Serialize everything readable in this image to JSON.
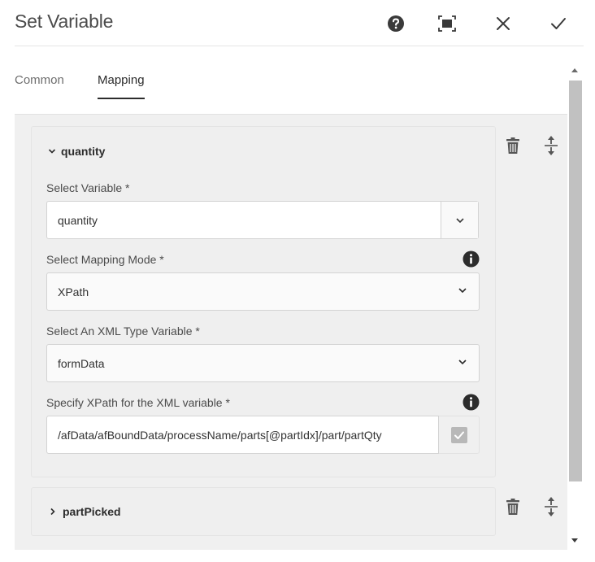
{
  "header": {
    "title": "Set Variable",
    "buttons": {
      "help": "help-icon",
      "fullscreen": "fullscreen-icon",
      "close": "close-icon",
      "confirm": "checkmark-icon"
    }
  },
  "tabs": [
    {
      "label": "Common",
      "active": false
    },
    {
      "label": "Mapping",
      "active": true
    }
  ],
  "mappings": [
    {
      "name": "quantity",
      "expanded": true,
      "fields": {
        "variable": {
          "label": "Select Variable *",
          "value": "quantity"
        },
        "mode": {
          "label": "Select Mapping Mode *",
          "value": "XPath"
        },
        "xml_var": {
          "label": "Select An XML Type Variable *",
          "value": "formData"
        },
        "xpath": {
          "label": "Specify XPath for the XML variable *",
          "value": "/afData/afBoundData/processName/parts[@partIdx]/part/partQty"
        }
      }
    },
    {
      "name": "partPicked",
      "expanded": false
    }
  ],
  "colors": {
    "accent": "#2c2c2c",
    "panel_bg": "#f0f0f0",
    "scroll_thumb": "#c1c1c1"
  }
}
